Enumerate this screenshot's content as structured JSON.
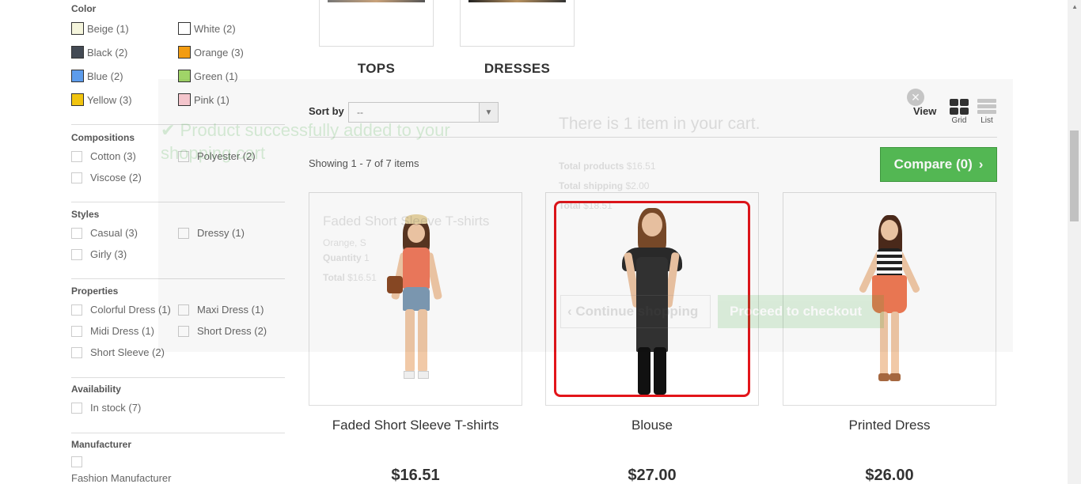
{
  "filters": {
    "color": {
      "title": "Color",
      "items": [
        {
          "label": "Beige (1)",
          "color": "#f5f5dc"
        },
        {
          "label": "White (2)",
          "color": "#ffffff"
        },
        {
          "label": "Black (2)",
          "color": "#434a54"
        },
        {
          "label": "Orange (3)",
          "color": "#f39c11"
        },
        {
          "label": "Blue (2)",
          "color": "#5d9cec"
        },
        {
          "label": "Green (1)",
          "color": "#a0d468"
        },
        {
          "label": "Yellow (3)",
          "color": "#f1c40f"
        },
        {
          "label": "Pink (1)",
          "color": "#fcccd3"
        }
      ]
    },
    "compositions": {
      "title": "Compositions",
      "items": [
        "Cotton (3)",
        "Polyester (2)",
        "Viscose (2)"
      ]
    },
    "styles": {
      "title": "Styles",
      "items": [
        "Casual (3)",
        "Dressy (1)",
        "Girly (3)"
      ]
    },
    "properties": {
      "title": "Properties",
      "items": [
        "Colorful Dress (1)",
        "Maxi Dress (1)",
        "Midi Dress (1)",
        "Short Dress (2)",
        "Short Sleeve (2)"
      ]
    },
    "availability": {
      "title": "Availability",
      "items": [
        "In stock (7)"
      ]
    },
    "manufacturer": {
      "title": "Manufacturer",
      "items": [
        "Fashion Manufacturer"
      ]
    }
  },
  "categories": [
    "TOPS",
    "DRESSES"
  ],
  "toolbar": {
    "sort_label": "Sort by",
    "sort_value": "--",
    "view_label": "View",
    "grid_label": "Grid",
    "list_label": "List",
    "showing": "Showing 1 - 7 of 7 items",
    "compare_label": "Compare (0)"
  },
  "products": [
    {
      "name": "Faded Short Sleeve T-shirts",
      "price": "$16.51"
    },
    {
      "name": "Blouse",
      "price": "$27.00"
    },
    {
      "name": "Printed Dress",
      "price": "$26.00"
    }
  ],
  "cart_popup": {
    "success": "Product successfully added to your shopping cart",
    "items_in_cart": "There is 1 item in your cart.",
    "product_name": "Faded Short Sleeve T-shirts",
    "attributes": "Orange, S",
    "quantity_label": "Quantity",
    "quantity": "1",
    "total_label": "Total",
    "total": "$16.51",
    "total_products_label": "Total products",
    "total_products": "$16.51",
    "total_shipping_label": "Total shipping",
    "total_shipping": "$2.00",
    "grand_total_label": "Total",
    "grand_total": "$18.51",
    "continue_label": "Continue shopping",
    "checkout_label": "Proceed to checkout"
  }
}
